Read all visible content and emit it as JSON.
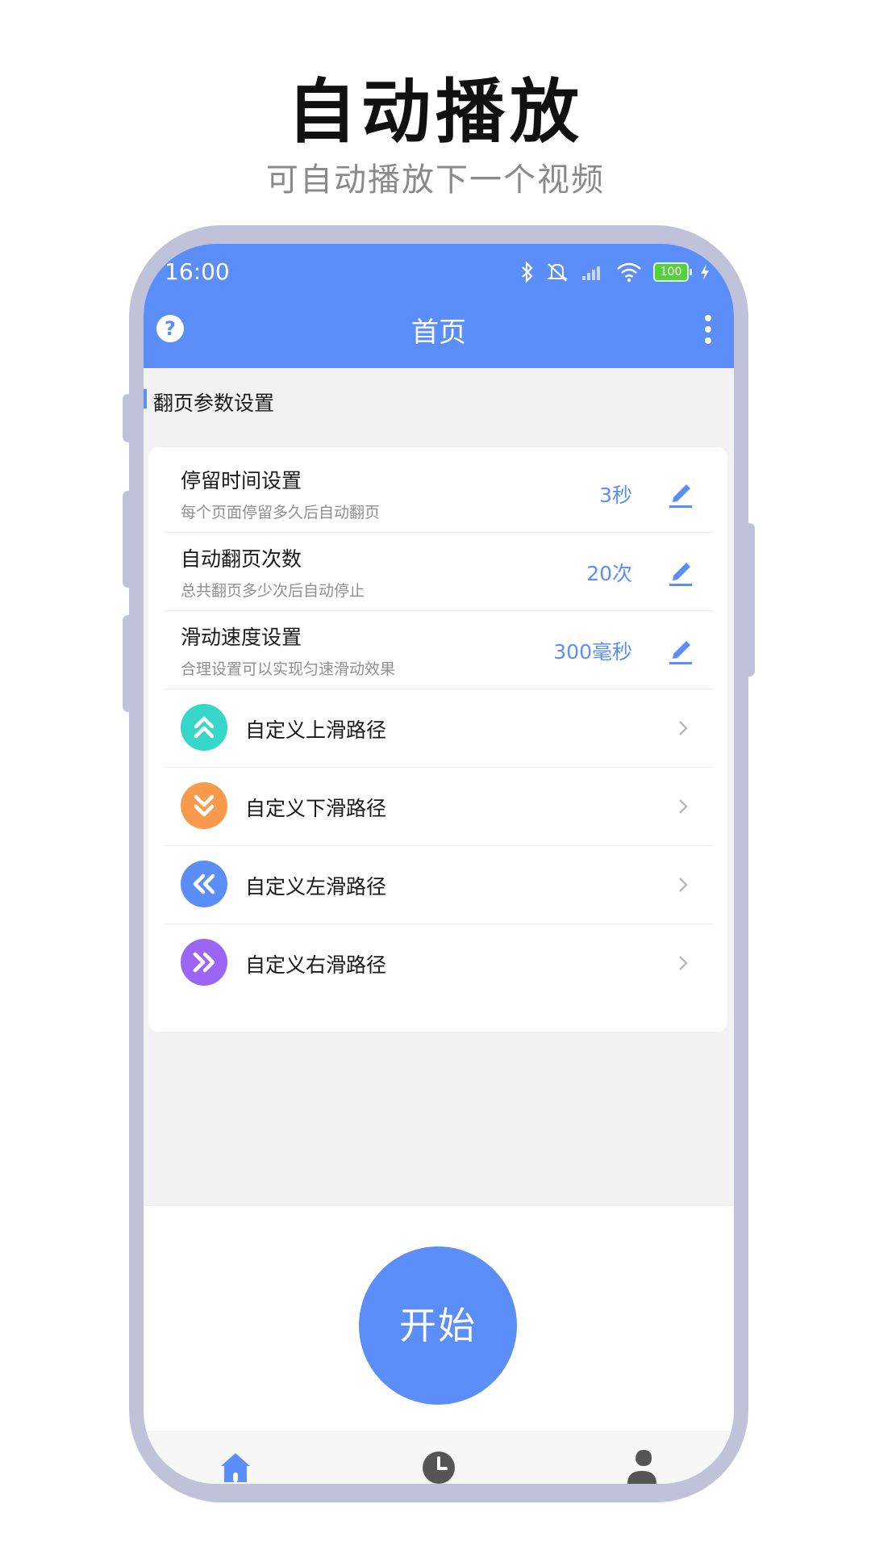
{
  "promo": {
    "title": "自动播放",
    "subtitle": "可自动播放下一个视频"
  },
  "status_bar": {
    "time": "16:00",
    "battery": "100",
    "icons": [
      "bluetooth-icon",
      "mute-icon",
      "signal-icon",
      "wifi-icon",
      "battery-icon",
      "charging-icon"
    ]
  },
  "header": {
    "title": "首页",
    "left_icon": "help-icon",
    "right_icon": "more-vertical-icon"
  },
  "section": {
    "title": "翻页参数设置"
  },
  "settings": [
    {
      "title": "停留时间设置",
      "description": "每个页面停留多久后自动翻页",
      "value": "3秒",
      "icon": "edit-icon"
    },
    {
      "title": "自动翻页次数",
      "description": "总共翻页多少次后自动停止",
      "value": "20次",
      "icon": "edit-icon"
    },
    {
      "title": "滑动速度设置",
      "description": "合理设置可以实现匀速滑动效果",
      "value": "300毫秒",
      "icon": "edit-icon"
    }
  ],
  "paths": [
    {
      "label": "自定义上滑路径",
      "icon": "double-chevron-up-icon",
      "color": "#36d6c9"
    },
    {
      "label": "自定义下滑路径",
      "icon": "double-chevron-down-icon",
      "color": "#f99a4c"
    },
    {
      "label": "自定义左滑路径",
      "icon": "double-chevron-left-icon",
      "color": "#5b8ef8"
    },
    {
      "label": "自定义右滑路径",
      "icon": "double-chevron-right-icon",
      "color": "#9b66f3"
    }
  ],
  "start_button": {
    "label": "开始"
  },
  "tabbar": {
    "tabs": [
      {
        "icon": "home-icon",
        "active": true
      },
      {
        "icon": "clock-icon",
        "active": false
      },
      {
        "icon": "user-icon",
        "active": false
      }
    ]
  },
  "colors": {
    "accent": "#5b8ef8",
    "phone_frame": "#bfc2d8",
    "background": "#f2f2f4"
  }
}
